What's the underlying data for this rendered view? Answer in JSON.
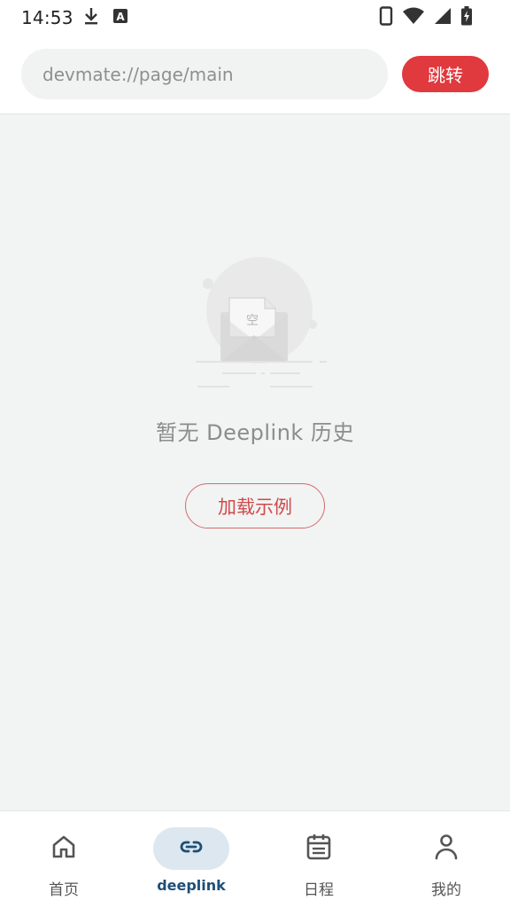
{
  "status_bar": {
    "time": "14:53",
    "left_icons": [
      "download-icon",
      "font-a-icon"
    ],
    "right_icons": [
      "phone-icon",
      "wifi-icon",
      "signal-icon",
      "battery-charging-icon"
    ]
  },
  "url_bar": {
    "placeholder": "devmate://page/main",
    "value": "",
    "jump_label": "跳转"
  },
  "empty_state": {
    "illustration_label": "空",
    "title": "暂无 Deeplink 历史",
    "load_sample_label": "加载示例"
  },
  "bottom_nav": {
    "items": [
      {
        "label": "首页",
        "icon": "home-icon",
        "active": false
      },
      {
        "label": "deeplink",
        "icon": "link-icon",
        "active": true
      },
      {
        "label": "日程",
        "icon": "calendar-icon",
        "active": false
      },
      {
        "label": "我的",
        "icon": "person-icon",
        "active": false
      }
    ]
  },
  "colors": {
    "accent_red": "#e0393e",
    "active_nav_bg": "#dde7ef",
    "active_nav_text": "#1d4f78",
    "background": "#f2f3f3"
  }
}
